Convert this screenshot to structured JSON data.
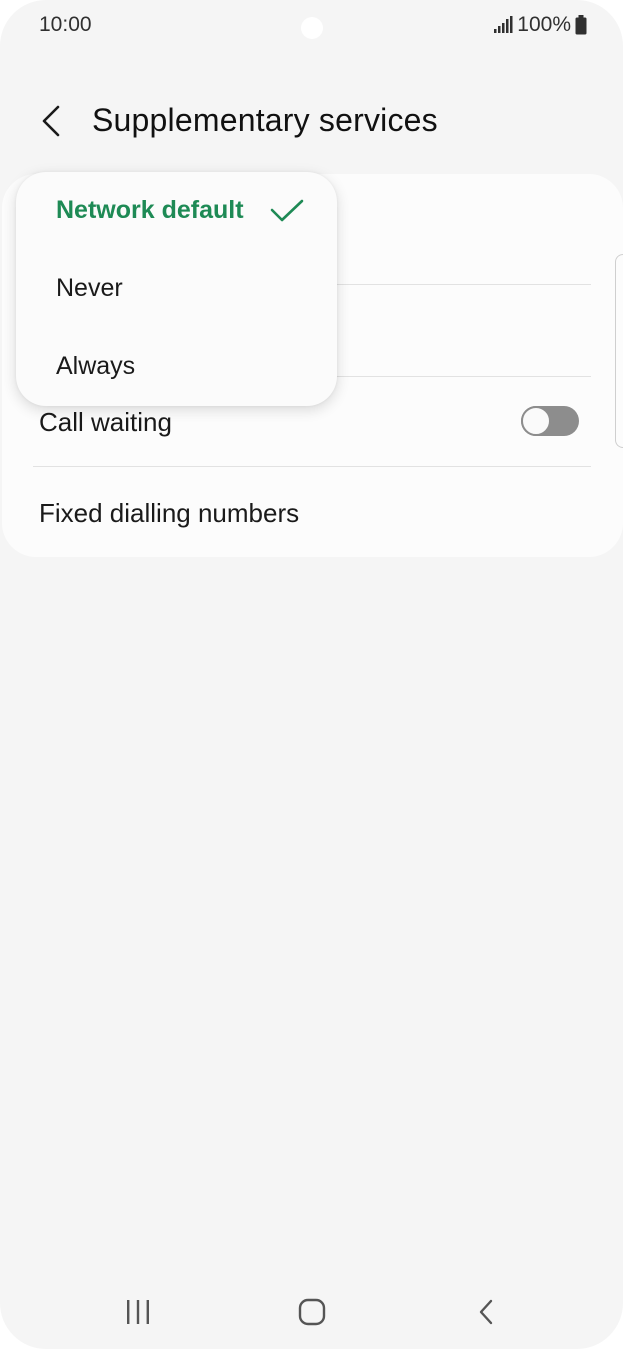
{
  "status_bar": {
    "time": "10:00",
    "battery": "100%",
    "icons": [
      "signal-icon",
      "battery-icon"
    ]
  },
  "header": {
    "title": "Supplementary services",
    "back_icon": "back-arrow-icon"
  },
  "settings": {
    "rows": [
      {
        "label": "Call waiting",
        "toggle_on": false
      },
      {
        "label": "Fixed dialling numbers"
      }
    ]
  },
  "dropdown": {
    "options": [
      {
        "label": "Network default",
        "selected": true
      },
      {
        "label": "Never",
        "selected": false
      },
      {
        "label": "Always",
        "selected": false
      }
    ],
    "accent_color": "#1e8a55"
  },
  "nav_bar": {
    "icons": [
      "recent-apps-icon",
      "home-icon",
      "back-icon"
    ]
  }
}
